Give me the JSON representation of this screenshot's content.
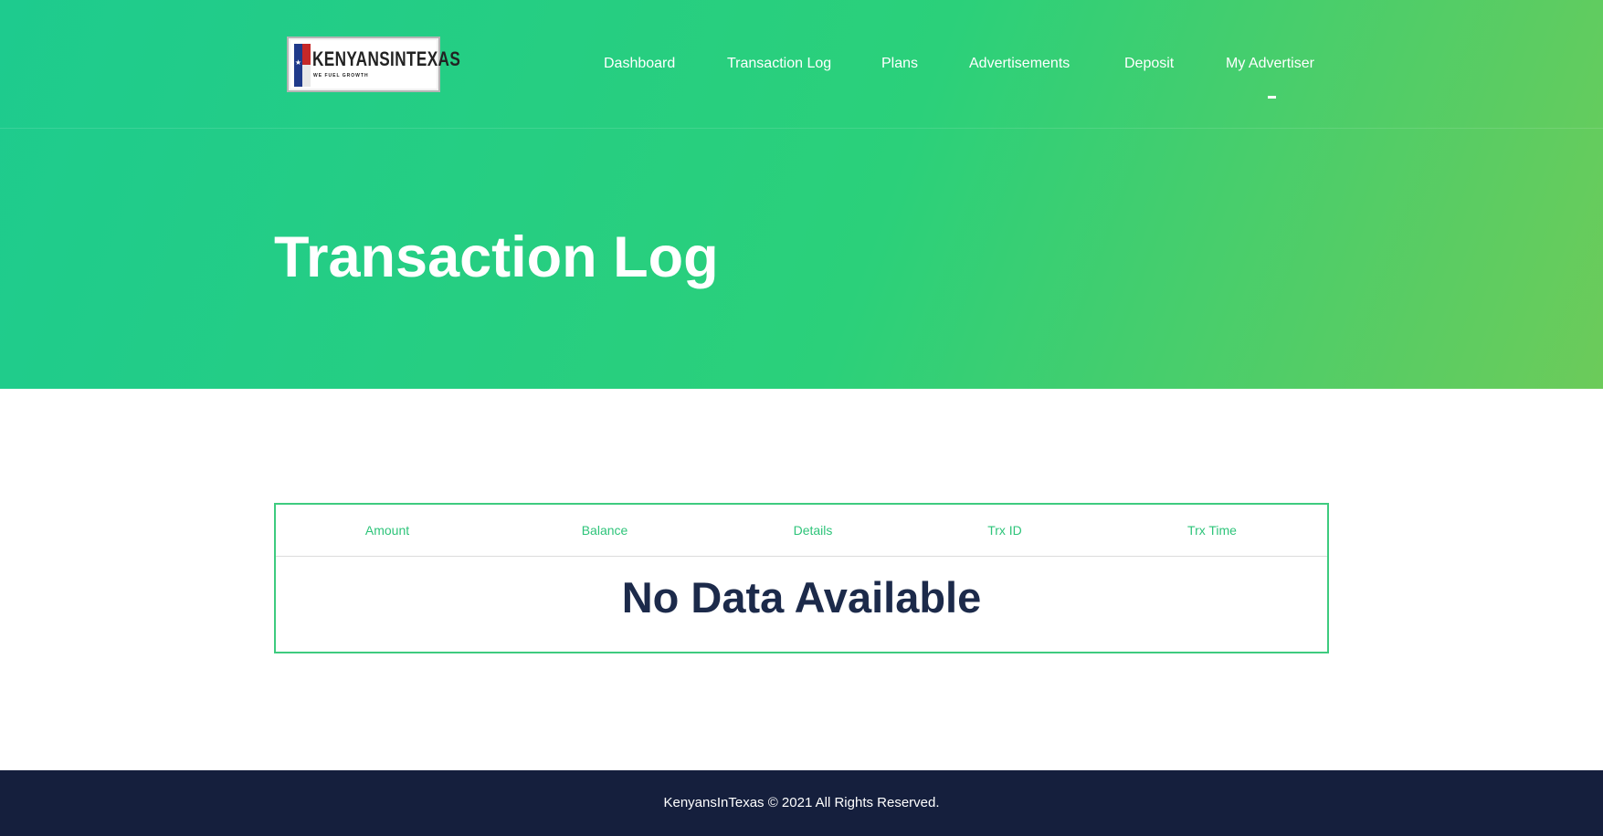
{
  "brand": {
    "logo_text": "KENYANSINTEXAS",
    "logo_tagline": "WE FUEL GROWTH"
  },
  "nav": {
    "items": [
      {
        "label": "Dashboard"
      },
      {
        "label": "Transaction Log"
      },
      {
        "label": "Plans"
      },
      {
        "label": "Advertisements"
      },
      {
        "label": "Deposit"
      },
      {
        "label": "My Advertiser"
      }
    ]
  },
  "page": {
    "title": "Transaction Log"
  },
  "table": {
    "columns": [
      "Amount",
      "Balance",
      "Details",
      "Trx ID",
      "Trx Time"
    ],
    "empty_message": "No Data Available"
  },
  "footer": {
    "copyright": "KenyansInTexas © 2021 All Rights Reserved."
  },
  "colors": {
    "hero_gradient_start": "#1ecb8e",
    "hero_gradient_end": "#6ccb5a",
    "accent_green": "#2ec47a",
    "heading_navy": "#1c2a4a",
    "footer_bg": "#151f3d"
  }
}
